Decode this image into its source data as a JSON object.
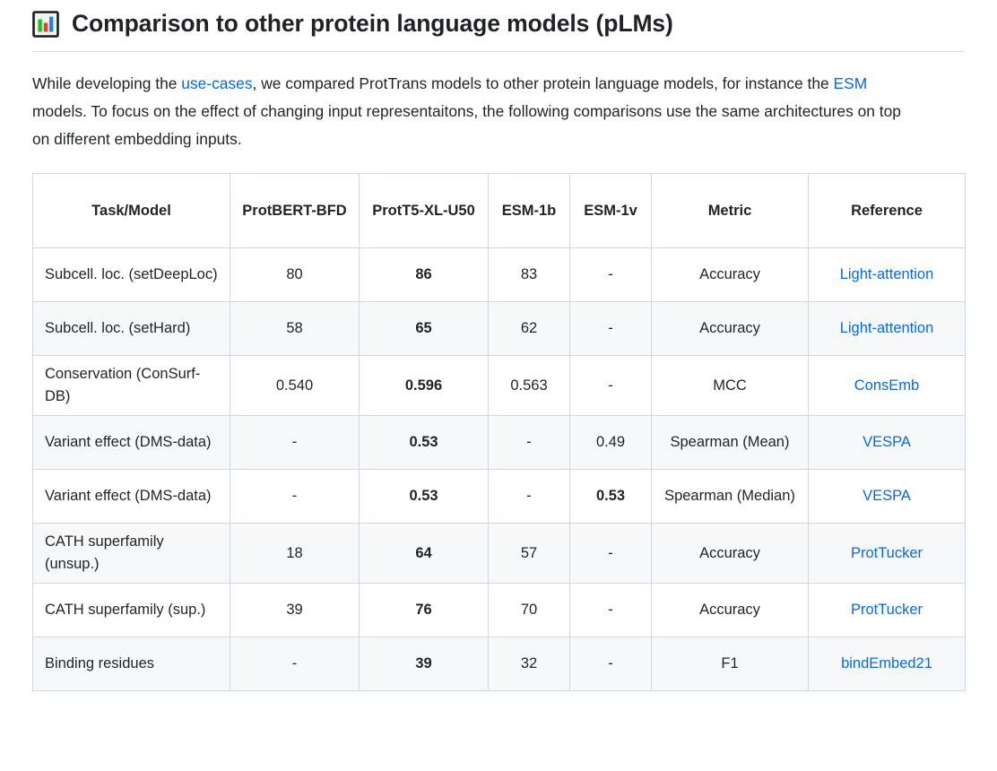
{
  "heading": {
    "icon": "bar-chart-emoji",
    "title": "Comparison to other protein language models (pLMs)"
  },
  "intro": {
    "part1": "While developing the ",
    "link1": "use-cases",
    "part2": ", we compared ProtTrans models to other protein language models, for instance the ",
    "link2": "ESM",
    "part3": " models. To focus on the effect of changing input representaitons, the following comparisons use the same architectures on top on different embedding inputs."
  },
  "colors": {
    "link": "#0969da",
    "text": "#1f2328",
    "border": "#d0d7de",
    "stripe": "#f6f8fa"
  },
  "table": {
    "columns": [
      "Task/Model",
      "ProtBERT-BFD",
      "ProtT5-XL-U50",
      "ESM-1b",
      "ESM-1v",
      "Metric",
      "Reference"
    ],
    "rows": [
      {
        "task": "Subcell. loc. (setDeepLoc)",
        "protbert_bfd": "80",
        "prott5_xl_u50": "86",
        "esm_1b": "83",
        "esm_1v": "-",
        "metric": "Accuracy",
        "reference": "Light-attention"
      },
      {
        "task": "Subcell. loc. (setHard)",
        "protbert_bfd": "58",
        "prott5_xl_u50": "65",
        "esm_1b": "62",
        "esm_1v": "-",
        "metric": "Accuracy",
        "reference": "Light-attention"
      },
      {
        "task": "Conservation (ConSurf-DB)",
        "protbert_bfd": "0.540",
        "prott5_xl_u50": "0.596",
        "esm_1b": "0.563",
        "esm_1v": "-",
        "metric": "MCC",
        "reference": "ConsEmb"
      },
      {
        "task": "Variant effect (DMS-data)",
        "protbert_bfd": "-",
        "prott5_xl_u50": "0.53",
        "esm_1b": "-",
        "esm_1v": "0.49",
        "metric": "Spearman (Mean)",
        "reference": "VESPA"
      },
      {
        "task": "Variant effect (DMS-data)",
        "protbert_bfd": "-",
        "prott5_xl_u50": "0.53",
        "esm_1b": "-",
        "esm_1v": "0.53",
        "metric": "Spearman (Median)",
        "reference": "VESPA"
      },
      {
        "task": "CATH superfamily (unsup.)",
        "protbert_bfd": "18",
        "prott5_xl_u50": "64",
        "esm_1b": "57",
        "esm_1v": "-",
        "metric": "Accuracy",
        "reference": "ProtTucker"
      },
      {
        "task": "CATH superfamily (sup.)",
        "protbert_bfd": "39",
        "prott5_xl_u50": "76",
        "esm_1b": "70",
        "esm_1v": "-",
        "metric": "Accuracy",
        "reference": "ProtTucker"
      },
      {
        "task": "Binding residues",
        "protbert_bfd": "-",
        "prott5_xl_u50": "39",
        "esm_1b": "32",
        "esm_1v": "-",
        "metric": "F1",
        "reference": "bindEmbed21"
      }
    ],
    "bold_cells": [
      [
        "prott5_xl_u50"
      ],
      [
        "prott5_xl_u50"
      ],
      [
        "prott5_xl_u50"
      ],
      [
        "prott5_xl_u50"
      ],
      [
        "prott5_xl_u50",
        "esm_1v"
      ],
      [
        "prott5_xl_u50"
      ],
      [
        "prott5_xl_u50"
      ],
      [
        "prott5_xl_u50"
      ]
    ]
  }
}
